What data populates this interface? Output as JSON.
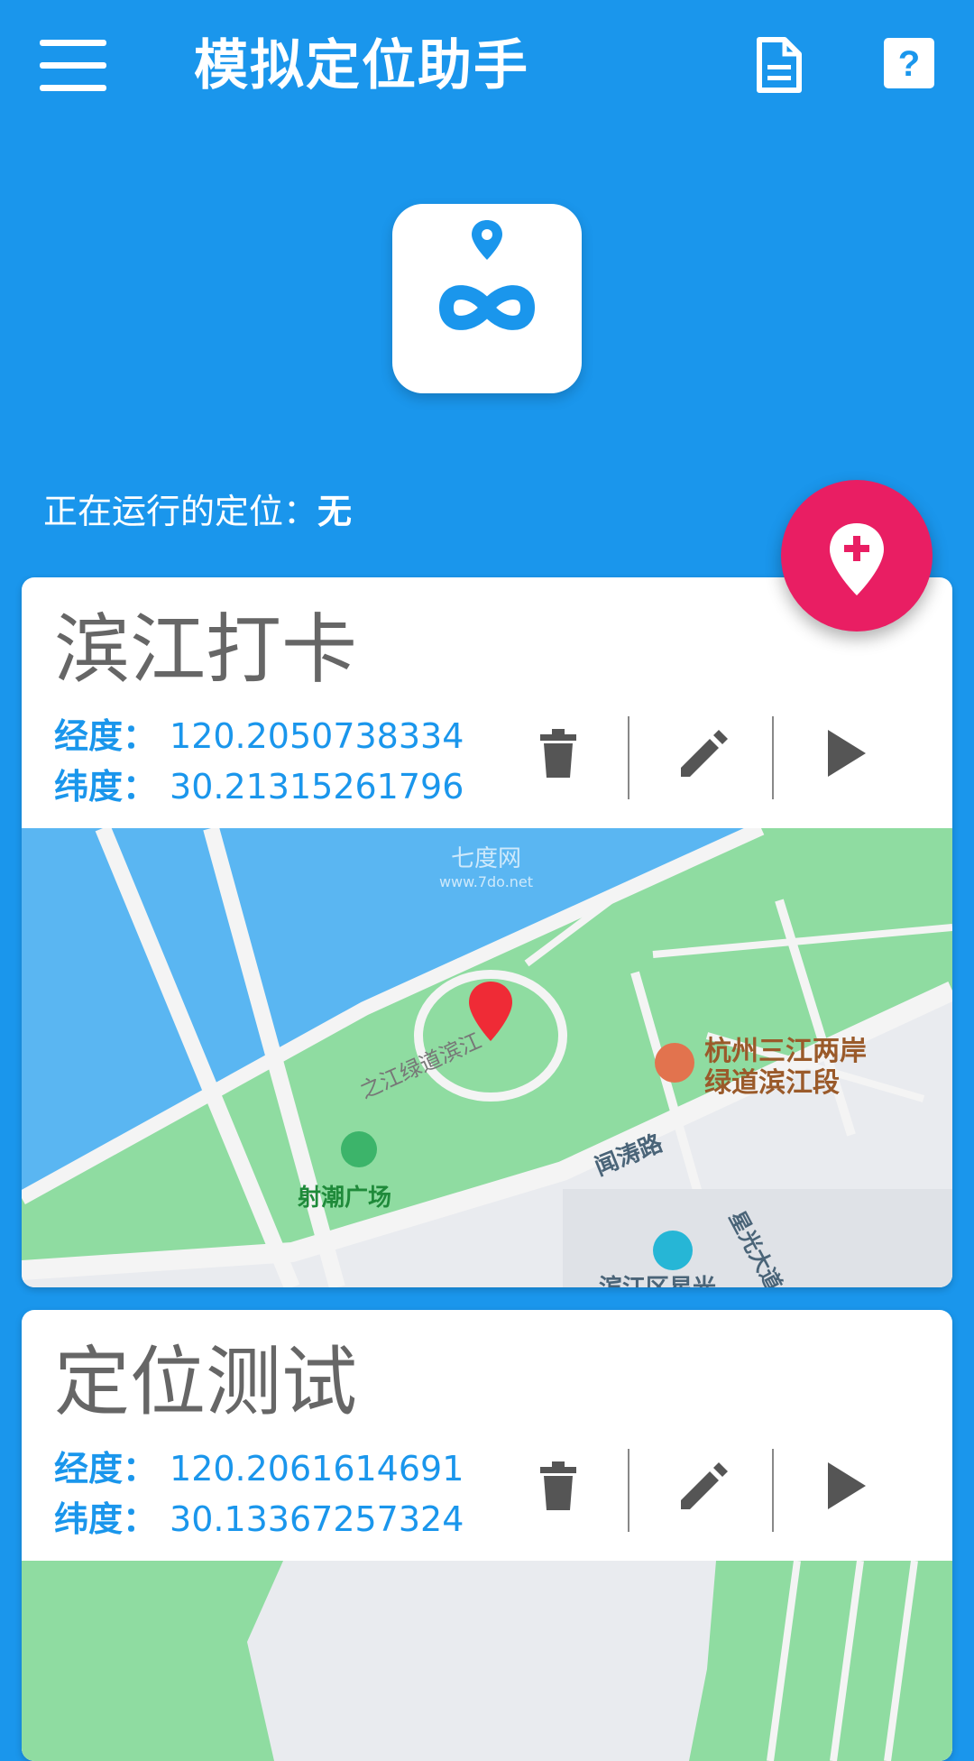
{
  "app_bar": {
    "title": "模拟定位助手",
    "icons": [
      "menu-icon",
      "document-icon",
      "help-icon"
    ],
    "help_glyph": "?"
  },
  "status": {
    "label": "正在运行的定位：",
    "value": "无"
  },
  "fab": {
    "icon": "add-location-icon"
  },
  "labels": {
    "longitude": "经度：",
    "latitude": "纬度："
  },
  "locations": [
    {
      "name": "滨江打卡",
      "longitude": "120.2050738334",
      "latitude": "30.21315261796",
      "map": {
        "pois": [
          "杭州三江两岸",
          "绿道滨江段",
          "射潮广场"
        ],
        "roads": [
          "之江绿道滨江",
          "闻涛路",
          "星光大道",
          "滨江区星光"
        ],
        "watermark": [
          "七度网",
          "www.7do.net"
        ]
      }
    },
    {
      "name": "定位测试",
      "longitude": "120.2061614691",
      "latitude": "30.13367257324"
    }
  ],
  "colors": {
    "primary": "#1a96ec",
    "accent": "#e91e63",
    "water": "#5ab6f2",
    "park": "#8fdca1"
  }
}
